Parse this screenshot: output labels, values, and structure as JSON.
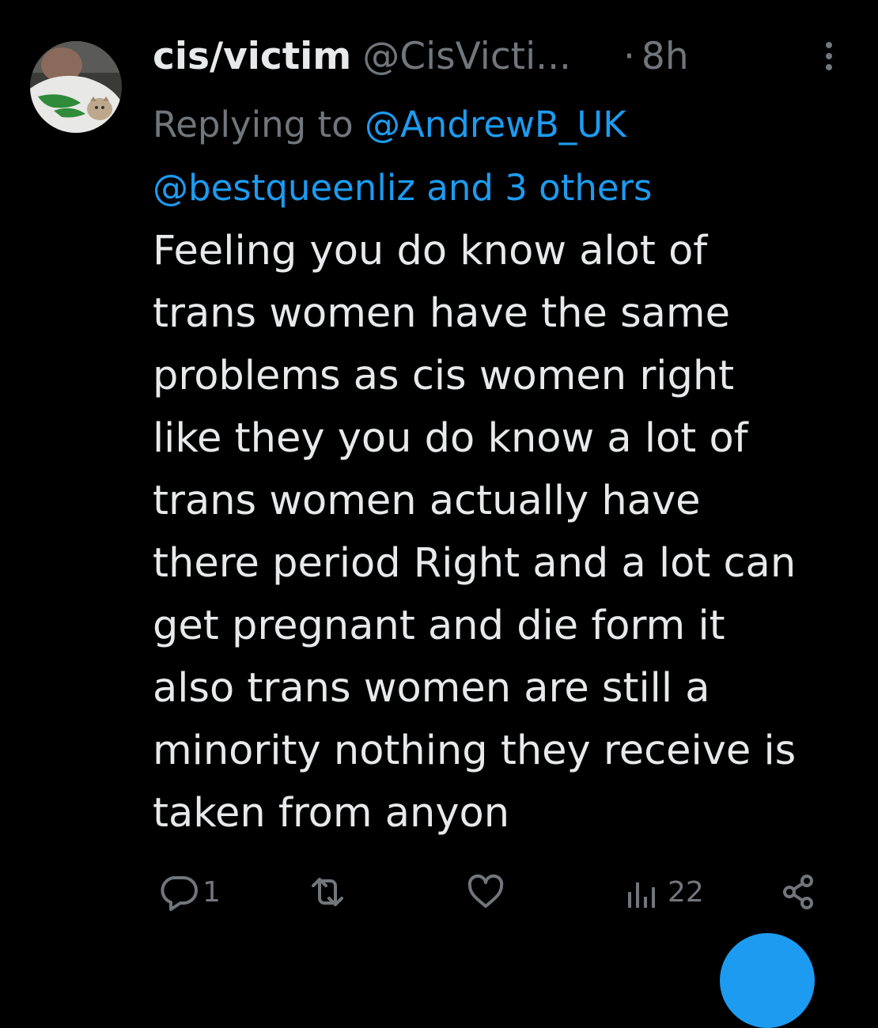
{
  "tweet": {
    "display_name": "cis/victim",
    "handle": "@CisVicti...",
    "separator": "·",
    "time": "8h",
    "more_icon": "more-vertical-icon",
    "reply": {
      "prefix": "Replying to",
      "mention_primary": "@AndrewB_UK",
      "mention_secondary": "@bestqueenliz",
      "suffix": "and 3 others"
    },
    "body_lines": [
      "Feeling you do know alot of",
      "trans women have the same",
      "problems as cis women right",
      "like they you do know a lot of",
      "trans women actually have",
      "there period Right and a lot can",
      "get pregnant and die form it",
      "also trans women are still a",
      "minority nothing they receive is",
      "taken from anyon"
    ],
    "actions": {
      "reply": {
        "icon": "reply-icon",
        "count": "1"
      },
      "retweet": {
        "icon": "retweet-icon",
        "count": ""
      },
      "like": {
        "icon": "heart-icon",
        "count": ""
      },
      "views": {
        "icon": "views-icon",
        "count": "22"
      },
      "share": {
        "icon": "share-icon",
        "count": ""
      }
    }
  },
  "colors": {
    "background": "#000000",
    "text_primary": "#e7e9ea",
    "text_secondary": "#71767b",
    "accent": "#1d9bf0"
  }
}
